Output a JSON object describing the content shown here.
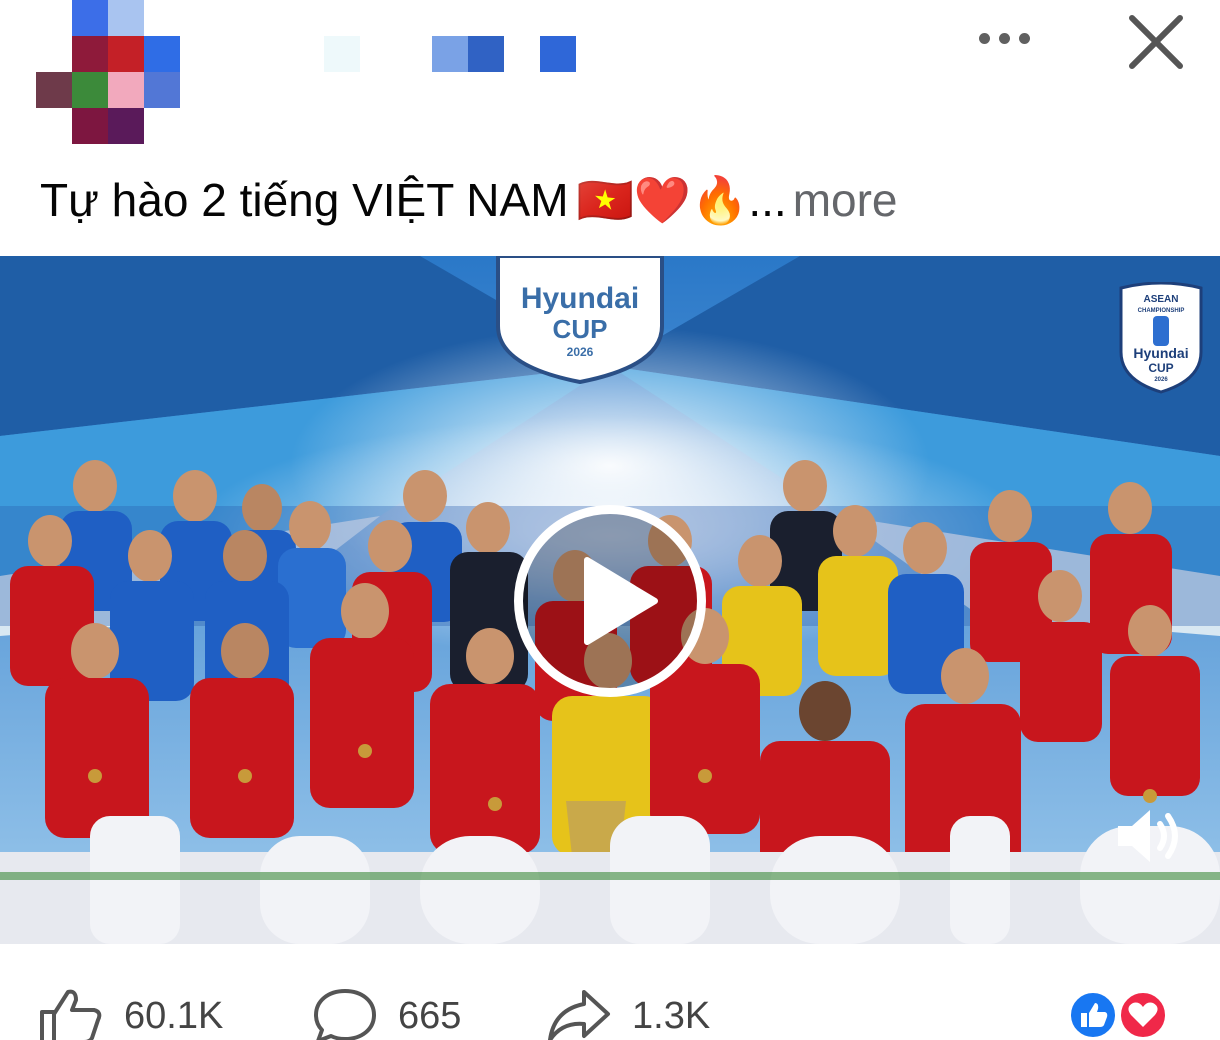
{
  "post": {
    "caption_text": "Tự hào 2 tiếng VIỆT NAM",
    "caption_emojis": "🇻🇳❤️🔥",
    "caption_ellipsis": "...",
    "more_label": "more"
  },
  "header": {
    "menu_icon": "more-horizontal-icon",
    "close_icon": "close-icon"
  },
  "video": {
    "overlay_logo_top": "ASEAN",
    "overlay_logo_sub": "CHAMPIONSHIP",
    "overlay_logo_brand": "Hyundai",
    "overlay_logo_cup": "CUP",
    "overlay_logo_year": "2026",
    "backdrop_brand": "Hyundai",
    "backdrop_cup": "CUP",
    "backdrop_year": "2026",
    "play_icon": "play-icon",
    "sound_icon": "speaker-icon"
  },
  "actions": {
    "likes": "60.1K",
    "comments": "665",
    "shares": "1.3K",
    "like_icon": "thumbs-up-icon",
    "comment_icon": "comment-icon",
    "share_icon": "share-icon"
  },
  "colors": {
    "like_blue": "#1877f2",
    "love_red": "#f02849",
    "muted_text": "#65676b",
    "jersey_red": "#c8161d",
    "jersey_blue": "#1f5fc4",
    "keeper_yellow": "#e6c31a"
  }
}
